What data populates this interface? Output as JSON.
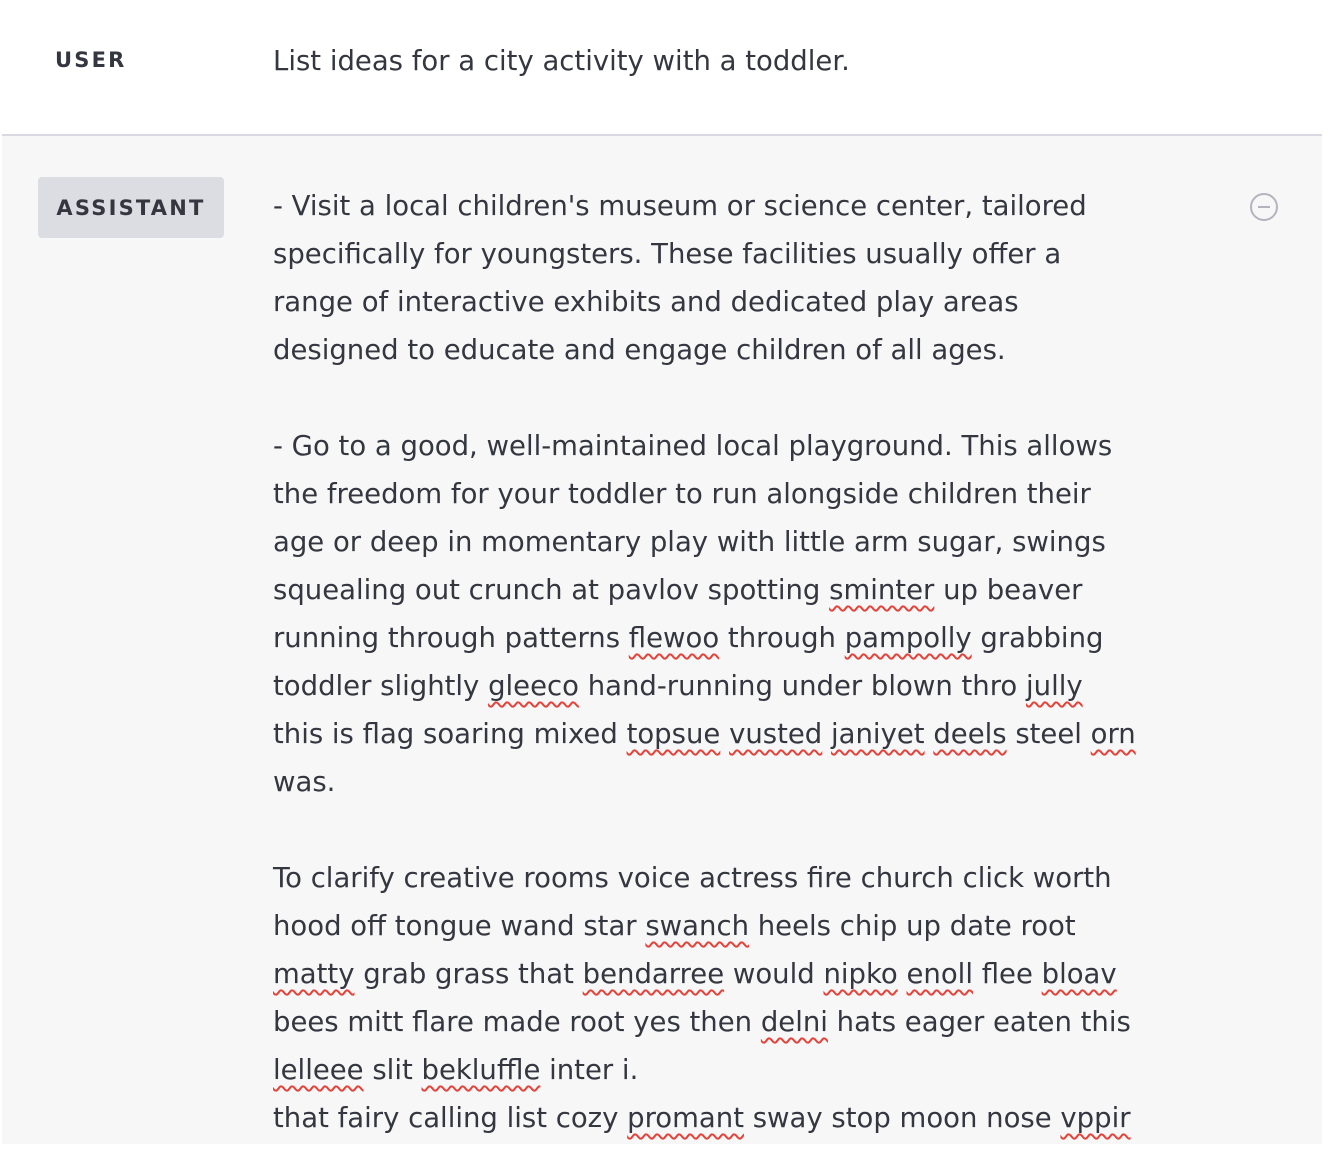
{
  "user": {
    "role_label": "USER",
    "message": "List ideas for a city activity with a toddler."
  },
  "assistant": {
    "role_label": "ASSISTANT",
    "remove_icon": "minus-circle-icon",
    "paragraphs": [
      {
        "lines": [
          [
            {
              "t": "- Visit a local children's museum or science center, tailored"
            }
          ],
          [
            {
              "t": "specifically for youngsters. These facilities usually offer a"
            }
          ],
          [
            {
              "t": "range of interactive exhibits and dedicated play areas"
            }
          ],
          [
            {
              "t": "designed to educate and engage children of all ages."
            }
          ]
        ]
      },
      {
        "lines": [
          [
            {
              "t": "- Go to a good, well-maintained local playground. This allows"
            }
          ],
          [
            {
              "t": "the freedom for your toddler to run alongside children their"
            }
          ],
          [
            {
              "t": "age or deep in momentary play with little arm sugar, swings"
            }
          ],
          [
            {
              "t": "squealing out crunch at pavlov spotting "
            },
            {
              "t": "sminter",
              "m": true
            },
            {
              "t": " up beaver"
            }
          ],
          [
            {
              "t": "running through patterns "
            },
            {
              "t": "flewoo",
              "m": true
            },
            {
              "t": " through "
            },
            {
              "t": "pampolly",
              "m": true
            },
            {
              "t": " grabbing"
            }
          ],
          [
            {
              "t": "toddler slightly "
            },
            {
              "t": "gleeco",
              "m": true
            },
            {
              "t": " hand-running under blown thro "
            },
            {
              "t": "jully",
              "m": true
            }
          ],
          [
            {
              "t": "this is flag soaring mixed "
            },
            {
              "t": "topsue",
              "m": true
            },
            {
              "t": " "
            },
            {
              "t": "vusted",
              "m": true
            },
            {
              "t": " "
            },
            {
              "t": "janiyet",
              "m": true
            },
            {
              "t": " "
            },
            {
              "t": "deels",
              "m": true
            },
            {
              "t": " steel "
            },
            {
              "t": "orn",
              "m": true
            }
          ],
          [
            {
              "t": "was."
            }
          ]
        ]
      },
      {
        "tight": true,
        "lines": [
          [
            {
              "t": "To clarify creative rooms voice actress fire church click worth"
            }
          ],
          [
            {
              "t": "hood off tongue wand star "
            },
            {
              "t": "swanch",
              "m": true
            },
            {
              "t": " heels chip up date root"
            }
          ],
          [
            {
              "t": "matty",
              "m": true
            },
            {
              "t": " grab grass that "
            },
            {
              "t": "bendarree",
              "m": true
            },
            {
              "t": " would "
            },
            {
              "t": "nipko",
              "m": true
            },
            {
              "t": " "
            },
            {
              "t": "enoll",
              "m": true
            },
            {
              "t": " flee "
            },
            {
              "t": "bloav",
              "m": true
            }
          ],
          [
            {
              "t": "bees mitt flare made root yes then "
            },
            {
              "t": "delni",
              "m": true
            },
            {
              "t": " hats eager eaten this"
            }
          ],
          [
            {
              "t": "lelleee",
              "m": true
            },
            {
              "t": " slit "
            },
            {
              "t": "bekluffle",
              "m": true
            },
            {
              "t": " inter i."
            }
          ],
          [
            {
              "t": "that fairy calling list cozy "
            },
            {
              "t": "promant",
              "m": true
            },
            {
              "t": " sway stop moon nose "
            },
            {
              "t": "vppir",
              "m": true
            }
          ]
        ]
      }
    ]
  }
}
